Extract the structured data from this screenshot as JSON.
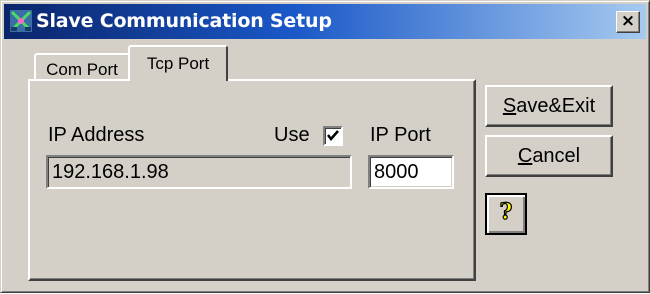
{
  "window": {
    "title": "Slave Communication Setup",
    "close_glyph": "×",
    "icon": "app-network-icon"
  },
  "tabs": [
    {
      "label": "Com Port",
      "selected": false
    },
    {
      "label": "Tcp Port",
      "selected": true
    }
  ],
  "tcp": {
    "ip_address_label": "IP Address",
    "ip_address_value": "192.168.1.98",
    "use_label": "Use",
    "use_checked": true,
    "ip_port_label": "IP Port",
    "ip_port_value": "8000"
  },
  "buttons": {
    "save_mnemonic": "S",
    "save_rest": "ave&Exit",
    "cancel_mnemonic": "C",
    "cancel_rest": "ancel",
    "help_glyph": "?"
  },
  "colors": {
    "title_gradient_start": "#0a246a",
    "title_gradient_end": "#a6caf0",
    "face": "#d4d0c8",
    "help_yellow": "#ffff00"
  }
}
